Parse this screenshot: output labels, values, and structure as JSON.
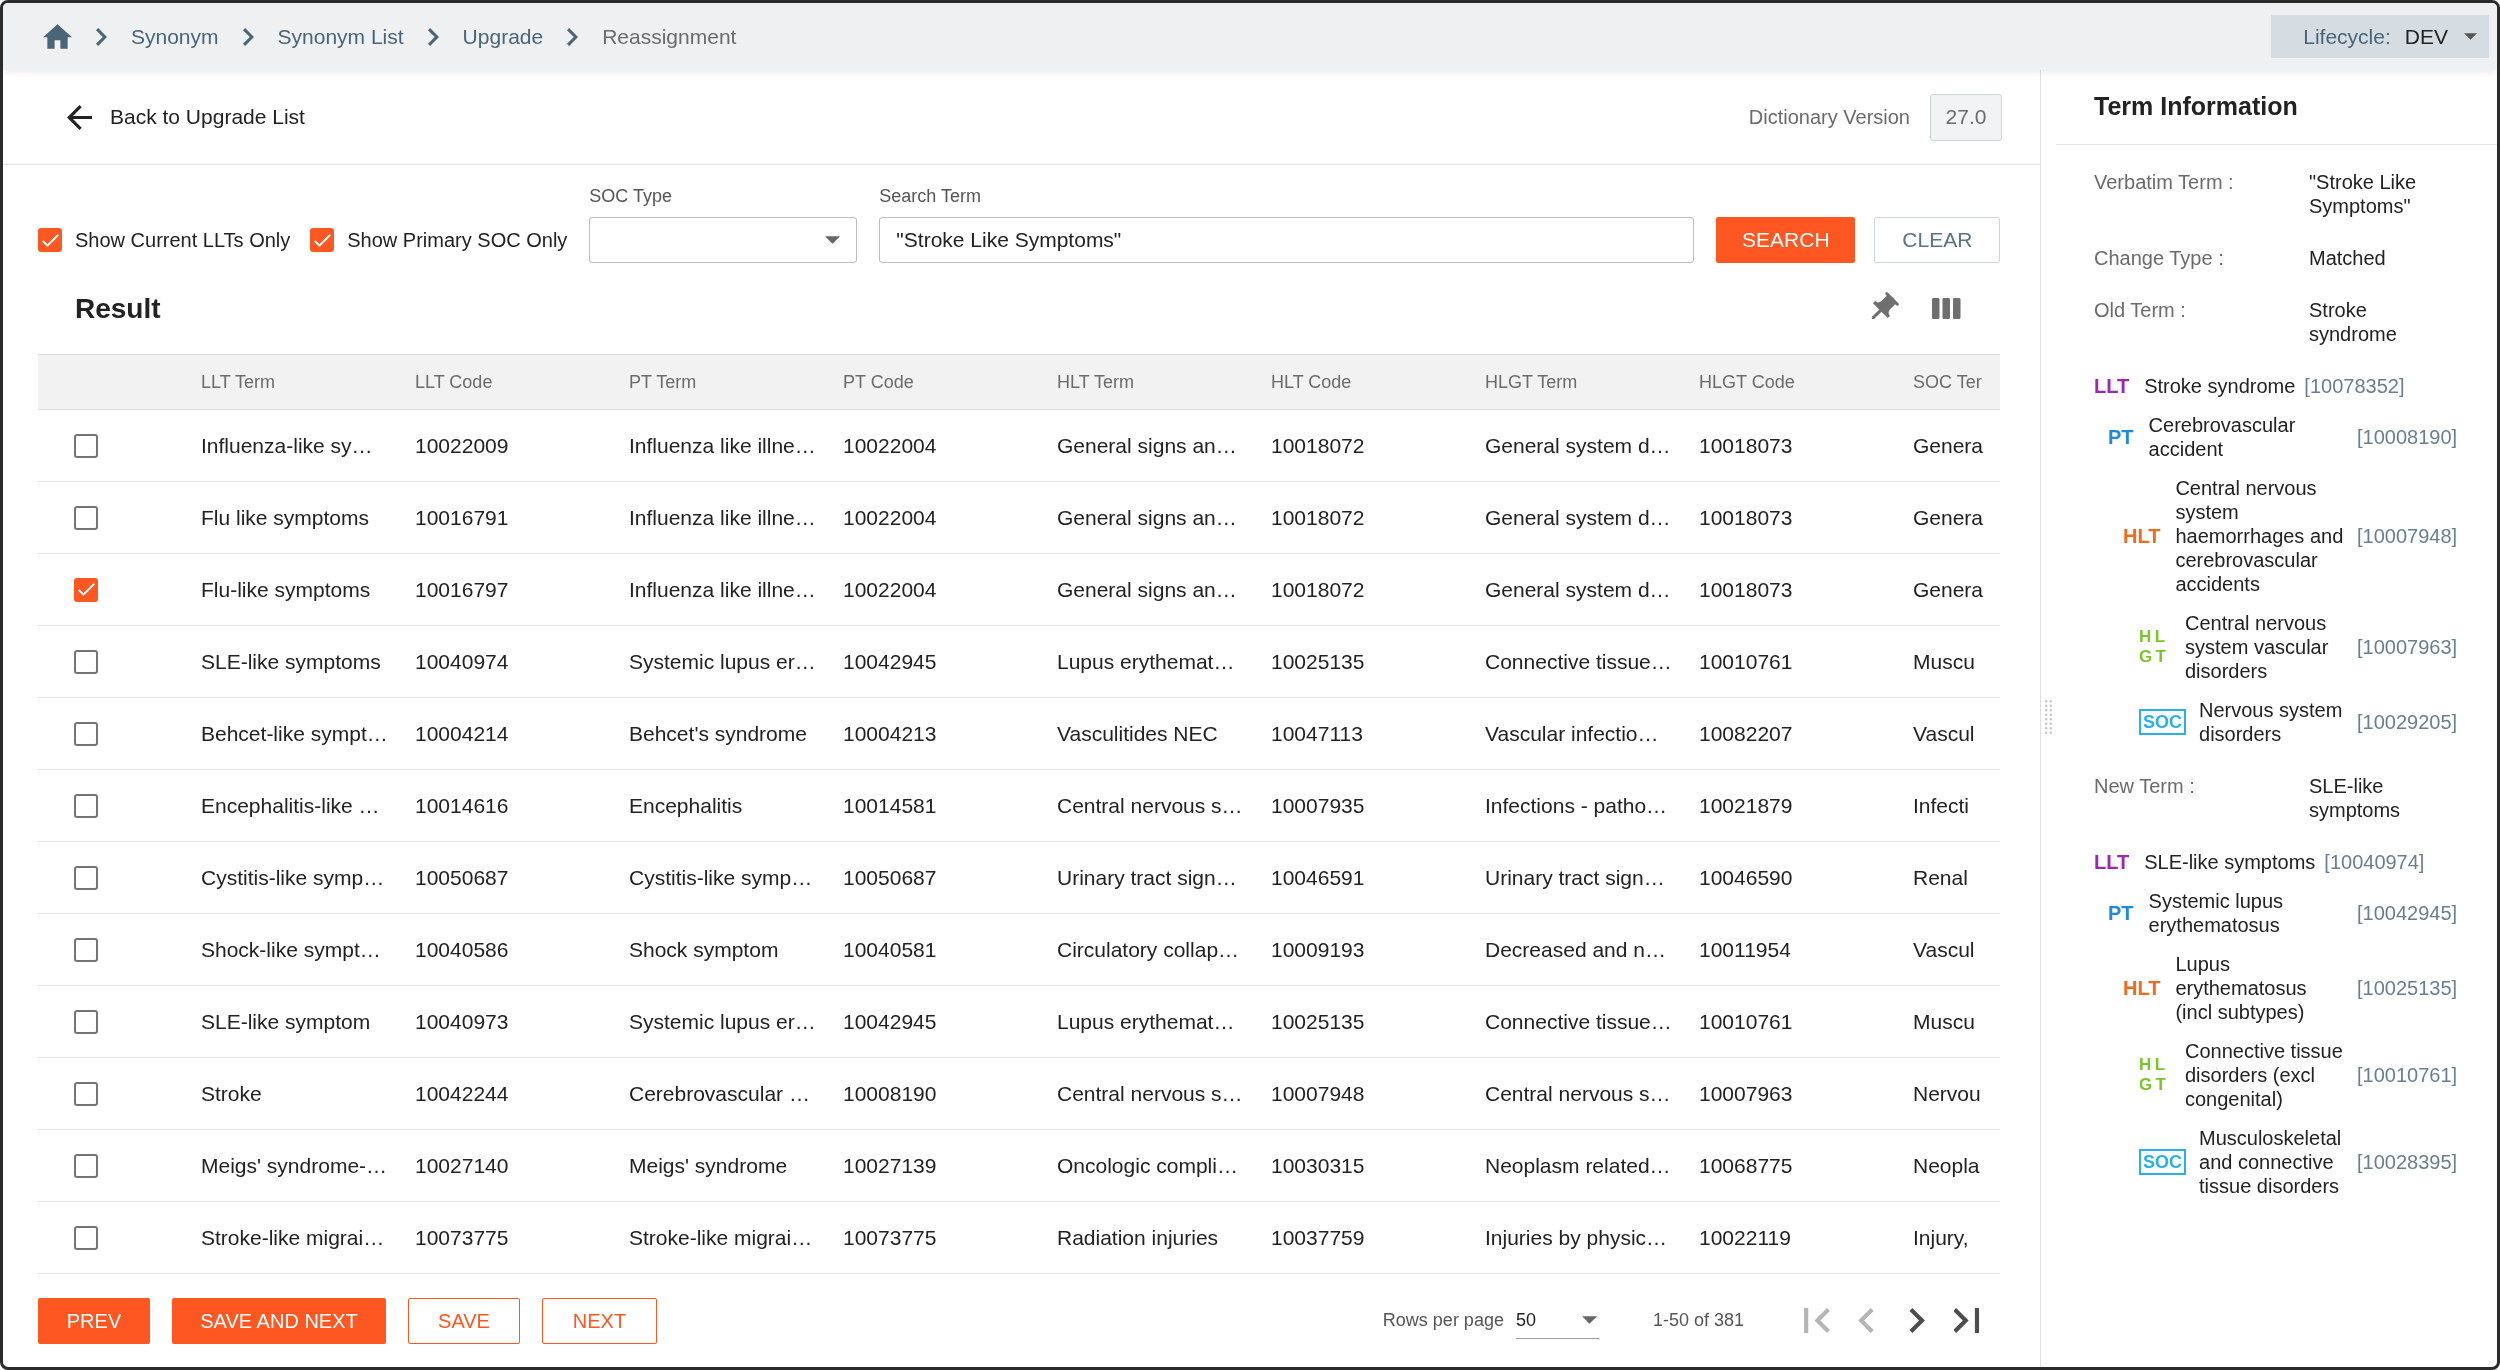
{
  "breadcrumb": [
    {
      "label": "Synonym",
      "current": false
    },
    {
      "label": "Synonym List",
      "current": false
    },
    {
      "label": "Upgrade",
      "current": false
    },
    {
      "label": "Reassignment",
      "current": true
    }
  ],
  "lifecycle": {
    "label": "Lifecycle:",
    "value": "DEV"
  },
  "header": {
    "back_link": "Back to Upgrade List",
    "dictionary_version": {
      "label": "Dictionary Version",
      "value": "27.0"
    }
  },
  "filters": {
    "checkboxes": [
      {
        "label": "Show Current LLTs Only",
        "checked": true
      },
      {
        "label": "Show Primary SOC Only",
        "checked": true
      }
    ],
    "soc_type": {
      "label": "SOC Type"
    },
    "search_term": {
      "label": "Search Term",
      "value": "\"Stroke Like Symptoms\""
    },
    "buttons": [
      {
        "label": "SEARCH",
        "kind": "primary"
      },
      {
        "label": "CLEAR",
        "kind": "secondary"
      }
    ]
  },
  "result": {
    "title": "Result",
    "table": {
      "columns": [
        "LLT Term",
        "LLT Code",
        "PT Term",
        "PT Code",
        "HLT Term",
        "HLT Code",
        "HLGT Term",
        "HLGT Code",
        "SOC Ter"
      ],
      "rows": [
        {
          "checked": false,
          "cells": [
            "Influenza-like sy…",
            "10022009",
            "Influenza like illne…",
            "10022004",
            "General signs an…",
            "10018072",
            "General system d…",
            "10018073",
            "Genera"
          ]
        },
        {
          "checked": false,
          "cells": [
            "Flu like symptoms",
            "10016791",
            "Influenza like illne…",
            "10022004",
            "General signs an…",
            "10018072",
            "General system d…",
            "10018073",
            "Genera"
          ]
        },
        {
          "checked": true,
          "cells": [
            "Flu-like symptoms",
            "10016797",
            "Influenza like illne…",
            "10022004",
            "General signs an…",
            "10018072",
            "General system d…",
            "10018073",
            "Genera"
          ]
        },
        {
          "checked": false,
          "cells": [
            "SLE-like symptoms",
            "10040974",
            "Systemic lupus er…",
            "10042945",
            "Lupus erythemat…",
            "10025135",
            "Connective tissue…",
            "10010761",
            "Muscu"
          ]
        },
        {
          "checked": false,
          "cells": [
            "Behcet-like sympt…",
            "10004214",
            "Behcet's syndrome",
            "10004213",
            "Vasculitides NEC",
            "10047113",
            "Vascular infectio…",
            "10082207",
            "Vascul"
          ]
        },
        {
          "checked": false,
          "cells": [
            "Encephalitis-like …",
            "10014616",
            "Encephalitis",
            "10014581",
            "Central nervous s…",
            "10007935",
            "Infections - patho…",
            "10021879",
            "Infecti"
          ]
        },
        {
          "checked": false,
          "cells": [
            "Cystitis-like symp…",
            "10050687",
            "Cystitis-like symp…",
            "10050687",
            "Urinary tract sign…",
            "10046591",
            "Urinary tract sign…",
            "10046590",
            "Renal"
          ]
        },
        {
          "checked": false,
          "cells": [
            "Shock-like sympt…",
            "10040586",
            "Shock symptom",
            "10040581",
            "Circulatory collap…",
            "10009193",
            "Decreased and n…",
            "10011954",
            "Vascul"
          ]
        },
        {
          "checked": false,
          "cells": [
            "SLE-like symptom",
            "10040973",
            "Systemic lupus er…",
            "10042945",
            "Lupus erythemat…",
            "10025135",
            "Connective tissue…",
            "10010761",
            "Muscu"
          ]
        },
        {
          "checked": false,
          "cells": [
            "Stroke",
            "10042244",
            "Cerebrovascular …",
            "10008190",
            "Central nervous s…",
            "10007948",
            "Central nervous s…",
            "10007963",
            "Nervou"
          ]
        },
        {
          "checked": false,
          "cells": [
            "Meigs' syndrome-…",
            "10027140",
            "Meigs' syndrome",
            "10027139",
            "Oncologic compli…",
            "10030315",
            "Neoplasm related…",
            "10068775",
            "Neopla"
          ]
        },
        {
          "checked": false,
          "cells": [
            "Stroke-like migrai…",
            "10073775",
            "Stroke-like migrai…",
            "10073775",
            "Radiation injuries",
            "10037759",
            "Injuries by physic…",
            "10022119",
            "Injury,"
          ]
        }
      ]
    }
  },
  "footer": {
    "buttons": [
      {
        "label": "PREV",
        "kind": "filled"
      },
      {
        "label": "SAVE AND NEXT",
        "kind": "filled"
      },
      {
        "label": "SAVE",
        "kind": "outlined"
      },
      {
        "label": "NEXT",
        "kind": "outlined"
      }
    ],
    "rows_per_page": {
      "label": "Rows per page",
      "value": "50"
    },
    "range": "1-50 of 381",
    "pager": [
      {
        "kind": "first",
        "disabled": true
      },
      {
        "kind": "previous",
        "disabled": true
      },
      {
        "kind": "next",
        "disabled": false
      },
      {
        "kind": "last",
        "disabled": false
      }
    ]
  },
  "term_information": {
    "title": "Term Information",
    "sections": [
      {
        "kind": "field",
        "label": "Verbatim Term :",
        "value": "\"Stroke Like Symptoms\""
      },
      {
        "kind": "field",
        "label": "Change Type :",
        "value": "Matched"
      },
      {
        "kind": "field",
        "label": "Old Term :",
        "value": "Stroke syndrome"
      },
      {
        "kind": "hierarchy",
        "root": {
          "tag": "LLT",
          "kind": "plain",
          "color": "#9c27b0",
          "name": "Stroke syndrome",
          "code": "[10078352]",
          "children": [
            {
              "tag": "PT",
              "kind": "plain",
              "color": "#1e88e5",
              "name": "Cerebrovascular accident",
              "code": "[10008190]",
              "children": [
                {
                  "tag": "HLT",
                  "kind": "plain",
                  "color": "#f26a1b",
                  "name": "Central nervous system haemorrhages and cerebrovascular accidents",
                  "code": "[10007948]",
                  "children": [
                    {
                      "tag": "HLGT",
                      "kind": "stacked",
                      "color": "#7ac52a",
                      "name": "Central nervous system vascular disorders",
                      "code": "[10007963]",
                      "children": [
                        {
                          "tag": "SOC",
                          "kind": "boxed",
                          "color": "#29b0ea",
                          "name": "Nervous system disorders",
                          "code": "[10029205]"
                        }
                      ]
                    }
                  ]
                }
              ]
            }
          ]
        }
      },
      {
        "kind": "field",
        "label": "New Term :",
        "value": "SLE-like symptoms"
      },
      {
        "kind": "hierarchy",
        "root": {
          "tag": "LLT",
          "kind": "plain",
          "color": "#9c27b0",
          "name": "SLE-like symptoms",
          "code": "[10040974]",
          "children": [
            {
              "tag": "PT",
              "kind": "plain",
              "color": "#1e88e5",
              "name": "Systemic lupus erythematosus",
              "code": "[10042945]",
              "children": [
                {
                  "tag": "HLT",
                  "kind": "plain",
                  "color": "#f26a1b",
                  "name": "Lupus erythematosus (incl subtypes)",
                  "code": "[10025135]",
                  "children": [
                    {
                      "tag": "HLGT",
                      "kind": "stacked",
                      "color": "#7ac52a",
                      "name": "Connective tissue disorders (excl congenital)",
                      "code": "[10010761]",
                      "children": [
                        {
                          "tag": "SOC",
                          "kind": "boxed",
                          "color": "#29b0ea",
                          "name": "Musculoskeletal and connective tissue disorders",
                          "code": "[10028395]"
                        }
                      ]
                    }
                  ]
                }
              ]
            }
          ]
        }
      }
    ]
  }
}
